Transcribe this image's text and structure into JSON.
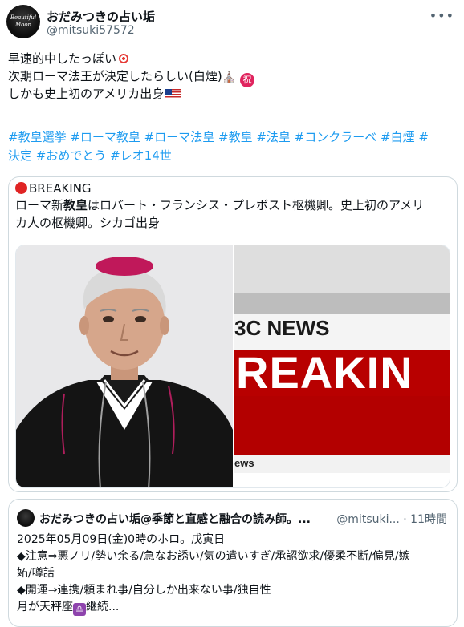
{
  "author": {
    "avatar_text": "Beautiful Moon",
    "display_name": "おだみつきの占い垢",
    "handle": "@mitsuki57572",
    "more_icon": "more-dots-icon"
  },
  "tweet": {
    "line1": "早速的中したっぽい",
    "line2": "次期ローマ法王が決定したらしい(白煙)",
    "line3": "しかも史上初のアメリカ出身",
    "iwai_char": "祝",
    "tower_glyph": "⛪",
    "hashtags_line1": "#教皇選挙 #ローマ教皇 #ローマ法皇 #教皇 #法皇 #コンクラーベ #白煙 #",
    "hashtags_line2": "決定 #おめでとう #レオ14世"
  },
  "quote": {
    "breaking_label": "BREAKING",
    "text_line1_pre": "ローマ新",
    "text_line1_bold": "教皇",
    "text_line1_post": "はロバート・フランシス・プレボスト枢機卿。史上初のアメリ",
    "text_line2": "カ人の枢機卿。シカゴ出身",
    "bbc_news_text": "3C NEWS",
    "bbc_breaking_text": "REAKIN",
    "bbc_lower_text": "ews"
  },
  "quote2": {
    "display_name": "おだみつきの占い垢@季節と直感と融合の読み師。...",
    "meta": "@mitsuki... · 11時間",
    "line1": "2025年05月09日(金)0時のホロ。戊寅日",
    "line2": "◆注意⇒悪ノリ/勢い余る/急なお誘い/気の遣いすぎ/承認欲求/優柔不断/偏見/嫉",
    "line3": "妬/噂話",
    "line4": "◆開運⇒連携/頼まれ事/自分しか出来ない事/独自性",
    "line5_pre": "月が天秤座",
    "libra_glyph": "♎",
    "line5_post": "継続..."
  },
  "colors": {
    "link": "#1d9bf0",
    "text": "#0f1419",
    "muted": "#536471",
    "bbc_red": "#b80000"
  }
}
